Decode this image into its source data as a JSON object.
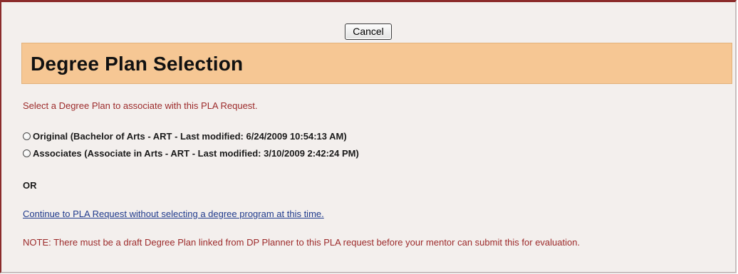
{
  "toolbar": {
    "cancel_label": "Cancel"
  },
  "header": {
    "title": "Degree Plan Selection"
  },
  "main": {
    "instruction": "Select a Degree Plan to associate with this PLA Request.",
    "options": [
      {
        "label": "Original (Bachelor of Arts - ART - Last modified: 6/24/2009 10:54:13 AM)",
        "selected": false
      },
      {
        "label": "Associates (Associate in Arts - ART - Last modified: 3/10/2009 2:42:24 PM)",
        "selected": false
      }
    ],
    "or_label": "OR",
    "continue_link": "Continue to PLA Request without selecting a degree program at this time.",
    "note": "NOTE: There must be a draft Degree Plan linked from DP Planner to this PLA request before your mentor can submit this for evaluation."
  },
  "colors": {
    "header_bg": "#f6c794",
    "accent_red": "#9c2a2a",
    "link_blue": "#1f3a8c",
    "frame_border": "#8b2b2b",
    "panel_bg": "#f3efed"
  }
}
